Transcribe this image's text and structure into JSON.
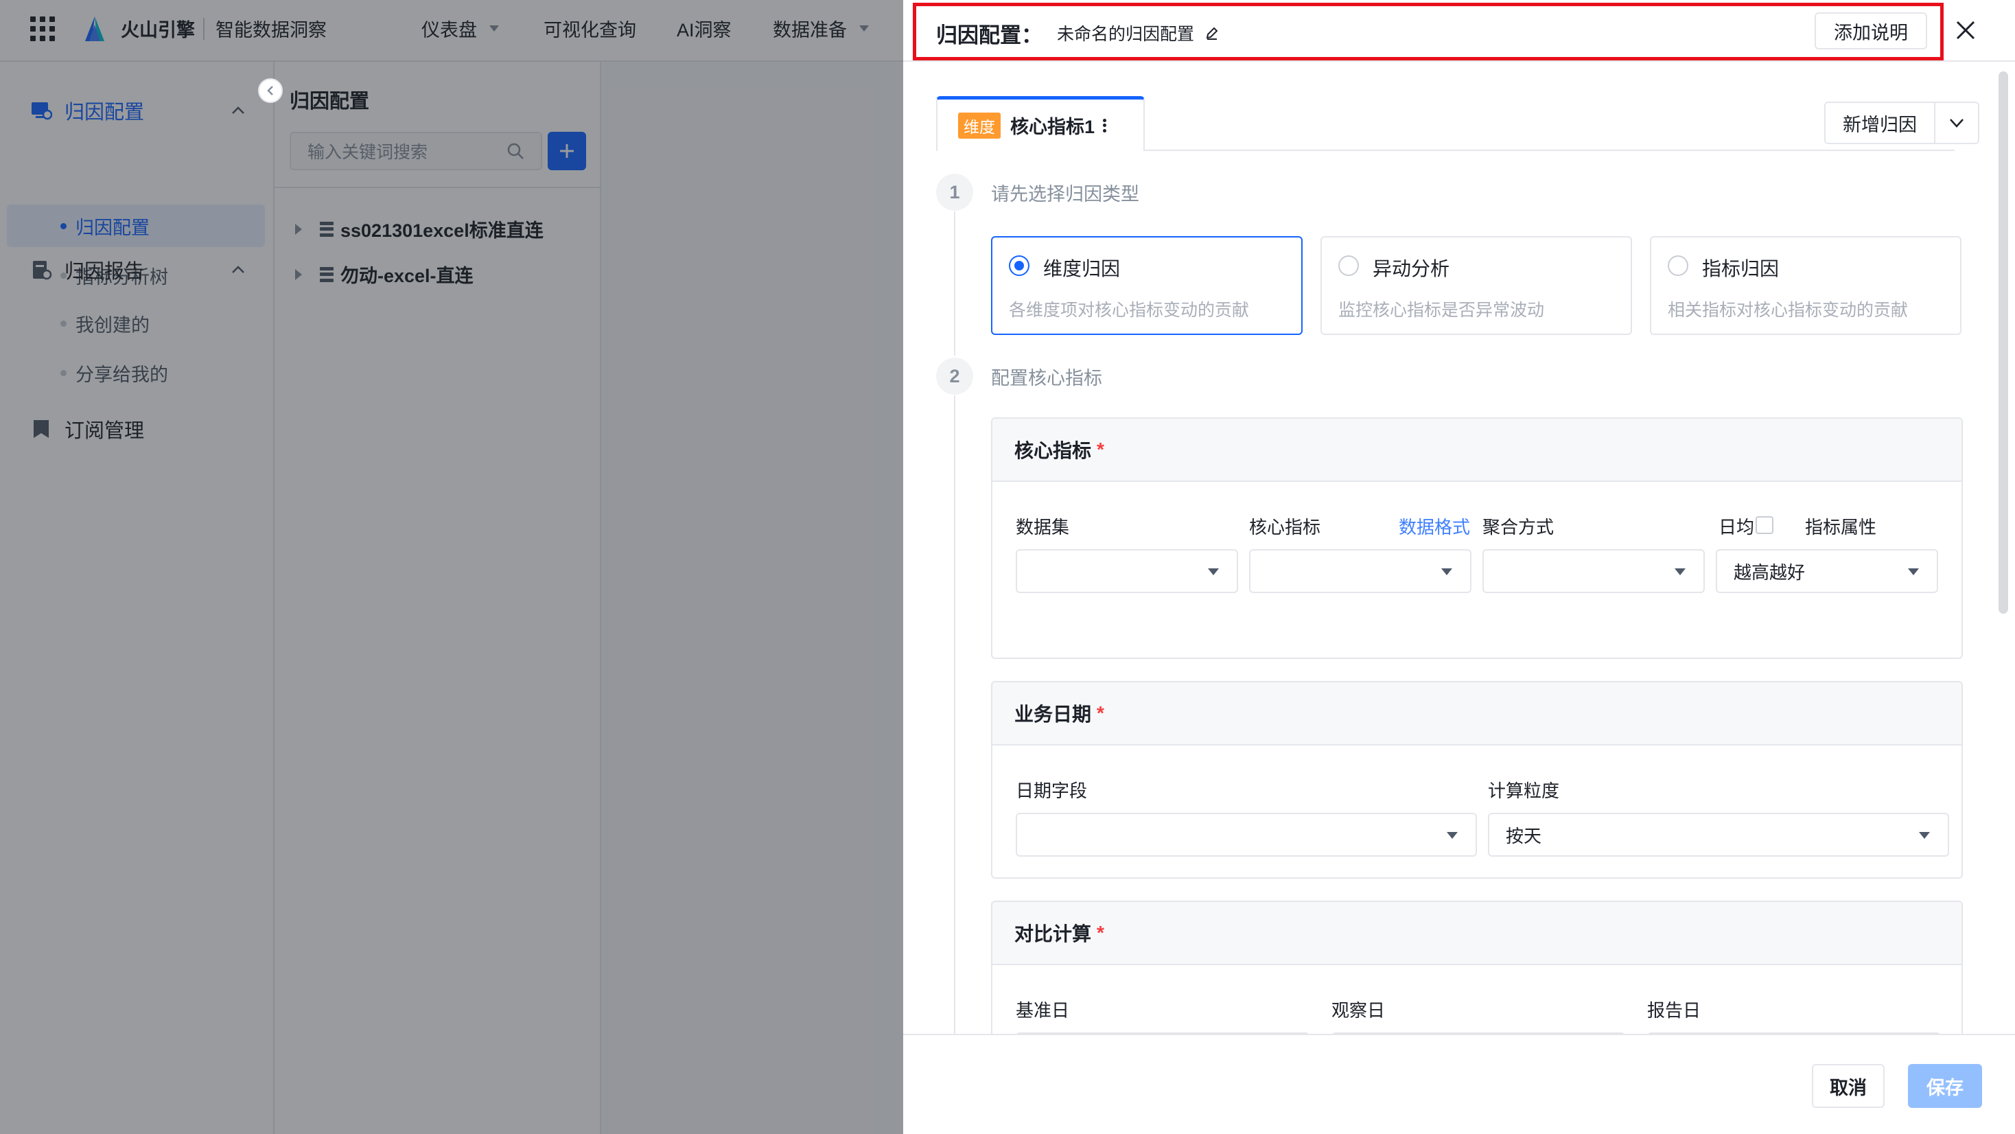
{
  "topbar": {
    "brand": "火山引擎",
    "product": "智能数据洞察",
    "nav": [
      {
        "label": "仪表盘",
        "has_caret": true
      },
      {
        "label": "可视化查询",
        "has_caret": false
      },
      {
        "label": "AI洞察",
        "has_caret": false
      },
      {
        "label": "数据准备",
        "has_caret": true
      }
    ]
  },
  "sidebar": {
    "groups": [
      {
        "label": "归因配置",
        "icon": "dashboard-icon",
        "expanded": true,
        "items": [
          "归因配置",
          "指标分析树"
        ]
      },
      {
        "label": "归因报告",
        "icon": "report-icon",
        "expanded": true,
        "items": [
          "我创建的",
          "分享给我的"
        ]
      },
      {
        "label": "订阅管理",
        "icon": "bookmark-icon",
        "expanded": false,
        "items": []
      }
    ],
    "active_item": "归因配置"
  },
  "tree": {
    "title": "归因配置",
    "search_placeholder": "输入关键词搜索",
    "nodes": [
      "ss021301excel标准直连",
      "勿动-excel-直连"
    ]
  },
  "drawer": {
    "title": "归因配置：",
    "name": "未命名的归因配置",
    "add_note_label": "添加说明",
    "tab": {
      "tag": "维度",
      "label": "核心指标1"
    },
    "new_attr_label": "新增归因",
    "step1": {
      "num": "1",
      "label": "请先选择归因类型"
    },
    "types": [
      {
        "name": "维度归因",
        "desc": "各维度项对核心指标变动的贡献",
        "selected": true
      },
      {
        "name": "异动分析",
        "desc": "监控核心指标是否异常波动",
        "selected": false
      },
      {
        "name": "指标归因",
        "desc": "相关指标对核心指标变动的贡献",
        "selected": false
      }
    ],
    "step2": {
      "num": "2",
      "label": "配置核心指标"
    },
    "core_section": {
      "title": "核心指标",
      "required_mark": "*",
      "fields": {
        "dataset_label": "数据集",
        "metric_label": "核心指标",
        "format_link": "数据格式",
        "agg_label": "聚合方式",
        "daily_label": "日均",
        "attr_label": "指标属性",
        "attr_value": "越高越好"
      }
    },
    "date_section": {
      "title": "业务日期",
      "required_mark": "*",
      "date_field_label": "日期字段",
      "granularity_label": "计算粒度",
      "granularity_value": "按天"
    },
    "compare_section": {
      "title": "对比计算",
      "required_mark": "*",
      "base_label": "基准日",
      "observe_label": "观察日",
      "report_label": "报告日"
    },
    "footer": {
      "cancel": "取消",
      "save": "保存"
    }
  },
  "colors": {
    "primary": "#1664ff",
    "highlight": "#e8101a",
    "tag": "#ff9a2e",
    "save_disabled": "#94bfff"
  }
}
